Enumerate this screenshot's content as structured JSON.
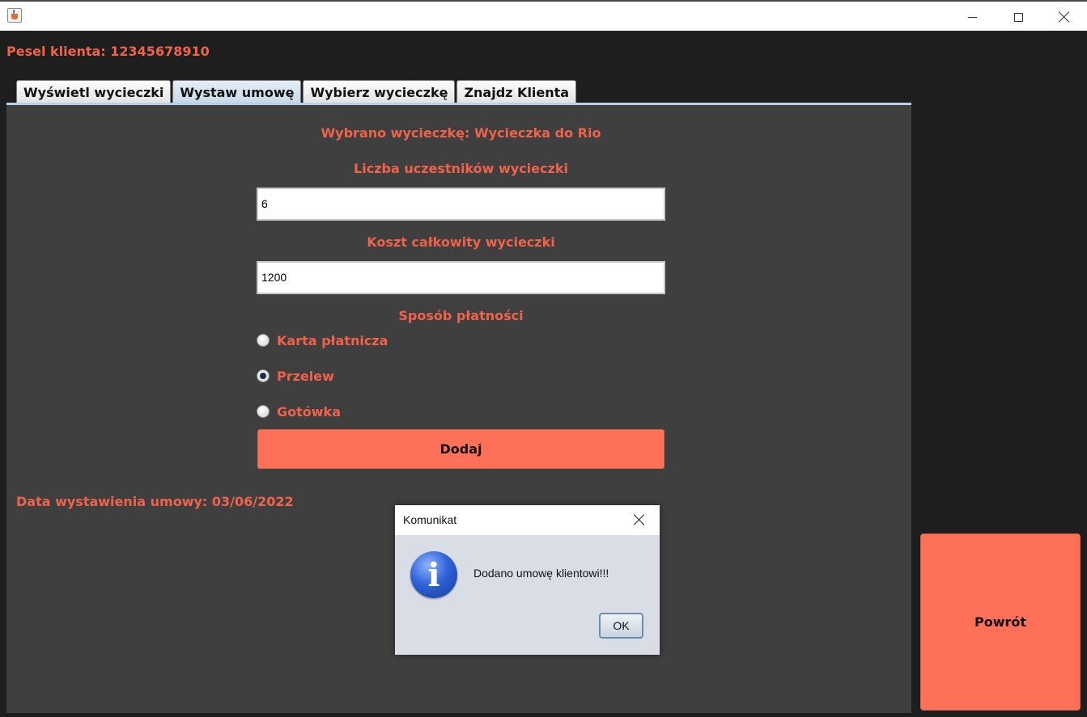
{
  "window": {
    "controls": [
      "minimize-icon",
      "maximize-icon",
      "close-icon"
    ]
  },
  "client": {
    "pesel_label": "Pesel klienta: 12345678910"
  },
  "tabs": [
    {
      "label": "Wyświetl wycieczki",
      "active": false
    },
    {
      "label": "Wystaw umowę",
      "active": true
    },
    {
      "label": "Wybierz wycieczkę",
      "active": false
    },
    {
      "label": "Znajdz Klienta",
      "active": false
    }
  ],
  "form": {
    "selected_trip": "Wybrano wycieczkę: Wycieczka do Rio",
    "participants_label": "Liczba uczestników wycieczki",
    "participants_value": "6",
    "cost_label": "Koszt całkowity wycieczki",
    "cost_value": "1200",
    "payment_label": "Sposób płatności",
    "payment_options": [
      {
        "label": "Karta płatnicza",
        "checked": false
      },
      {
        "label": "Przelew",
        "checked": true
      },
      {
        "label": "Gotówka",
        "checked": false
      }
    ],
    "add_button": "Dodaj",
    "issue_date": "Data wystawienia umowy: 03/06/2022"
  },
  "back_button": "Powrót",
  "dialog": {
    "title": "Komunikat",
    "icon": "info-icon",
    "message": "Dodano umowę klientowi!!!",
    "ok_button": "OK"
  },
  "colors": {
    "accent_text": "#f0624a",
    "button_bg": "#ff7059",
    "panel_bg": "#3f3f3f",
    "window_bg": "#1e1e1e"
  }
}
